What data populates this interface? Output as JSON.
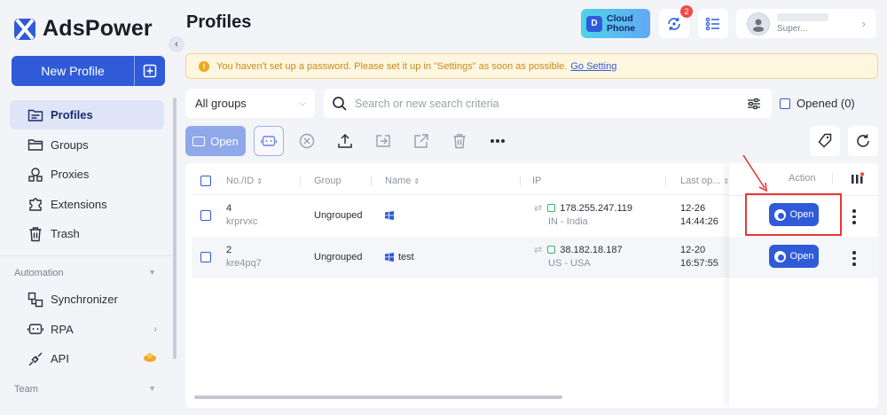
{
  "app": {
    "logo_text": "AdsPower",
    "new_profile_label": "New Profile"
  },
  "sidebar": {
    "items": [
      {
        "label": "Profiles",
        "icon": "profiles-icon",
        "active": true
      },
      {
        "label": "Groups",
        "icon": "folder-icon"
      },
      {
        "label": "Proxies",
        "icon": "proxies-icon"
      },
      {
        "label": "Extensions",
        "icon": "puzzle-icon"
      },
      {
        "label": "Trash",
        "icon": "trash-icon"
      }
    ],
    "automation_title": "Automation",
    "automation_items": [
      {
        "label": "Synchronizer",
        "icon": "synchronizer-icon"
      },
      {
        "label": "RPA",
        "icon": "robot-icon"
      },
      {
        "label": "API",
        "icon": "api-icon"
      }
    ],
    "team_title": "Team"
  },
  "header": {
    "title": "Profiles",
    "cloud_phone_line1": "Cloud",
    "cloud_phone_line2": "Phone",
    "notification_count": "2",
    "user_name": "Super..."
  },
  "warning": {
    "text": "You haven't set up a password. Please set it up in \"Settings\" as soon as possible.",
    "link": "Go Setting"
  },
  "filters": {
    "group_select": "All groups",
    "search_placeholder": "Search or new search criteria",
    "opened_label": "Opened (0)"
  },
  "toolbar": {
    "open_label": "Open"
  },
  "table": {
    "columns": {
      "no_id": "No./ID",
      "group": "Group",
      "name": "Name",
      "ip": "IP",
      "last_opened": "Last op...",
      "action": "Action"
    },
    "rows": [
      {
        "no": "4",
        "id": "krprvxc",
        "group": "Ungrouped",
        "name": "",
        "ip": "178.255.247.119",
        "location": "IN - India",
        "date": "12-26",
        "time": "14:44:26",
        "action": "Open"
      },
      {
        "no": "2",
        "id": "kre4pq7",
        "group": "Ungrouped",
        "name": "test",
        "ip": "38.182.18.187",
        "location": "US - USA",
        "date": "12-20",
        "time": "16:57:55",
        "action": "Open"
      }
    ]
  },
  "colors": {
    "brand": "#2f5bd9",
    "warning_text": "#c98a1a",
    "highlight_box": "#e53935"
  }
}
